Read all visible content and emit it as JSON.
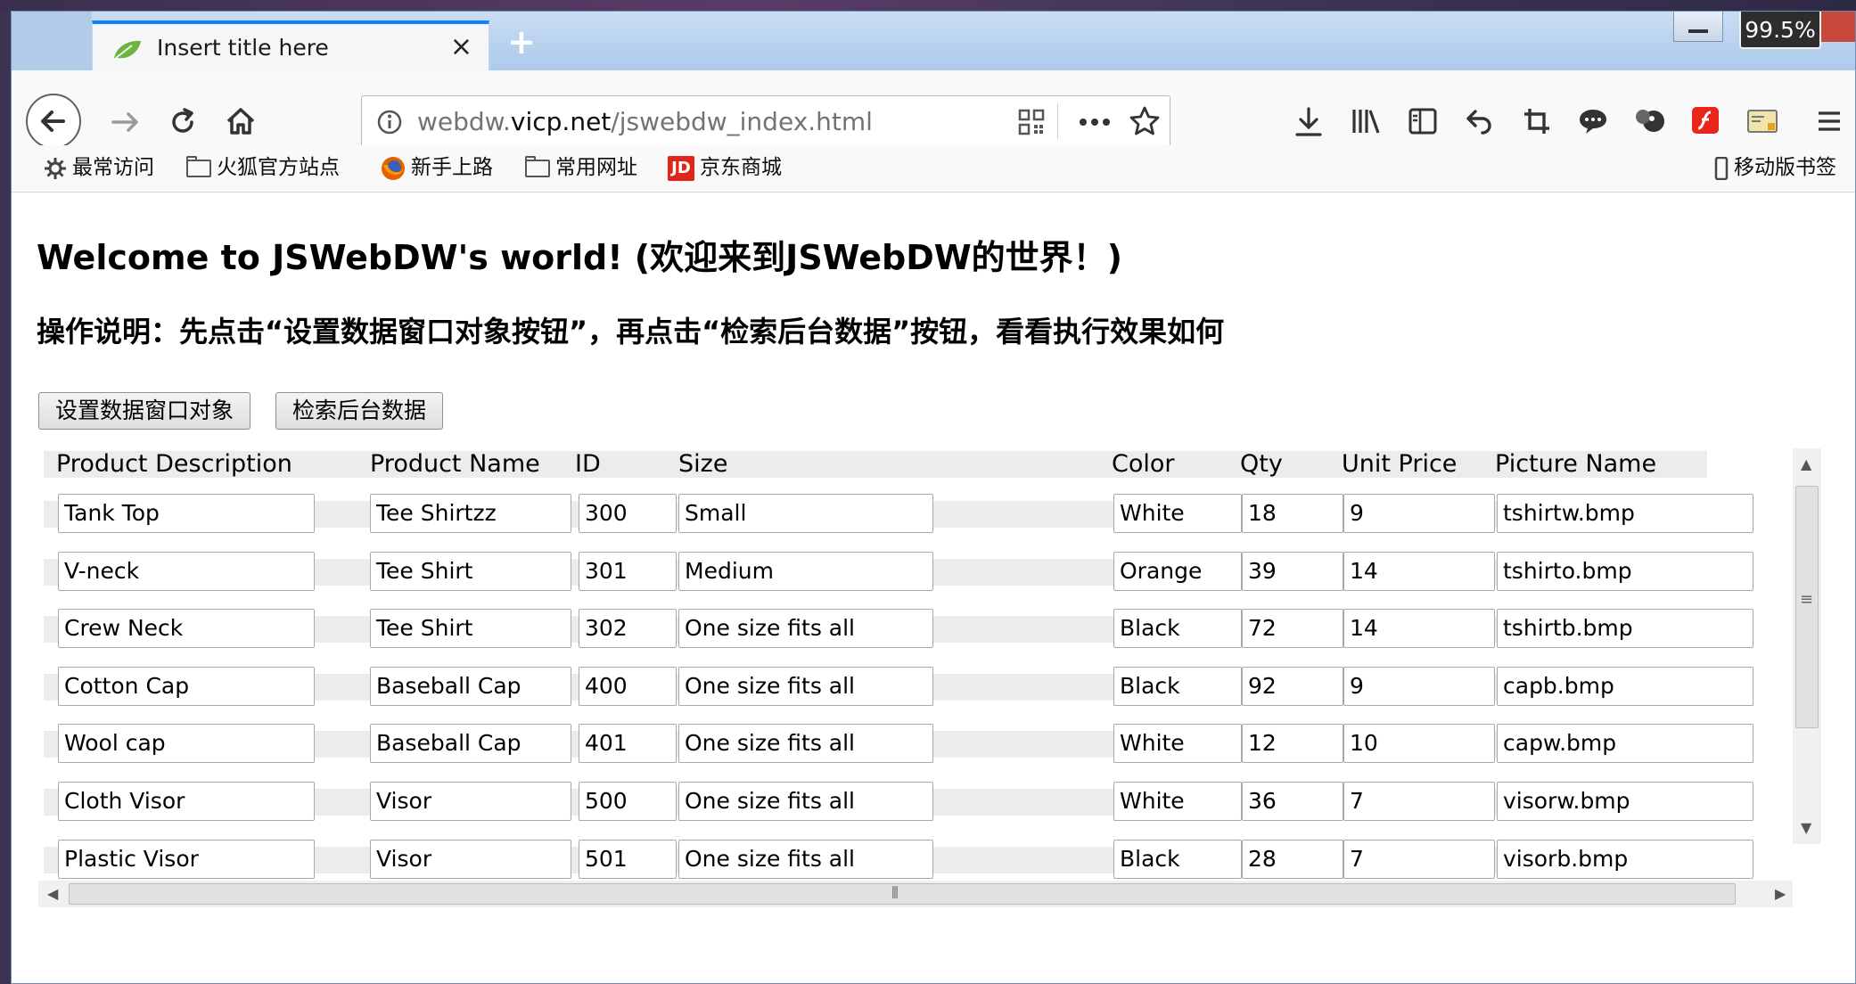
{
  "browser": {
    "tab_title": "Insert title here",
    "tab_close": "×",
    "new_tab": "+",
    "zoom": "99.5%",
    "url_prefix": "webdw.",
    "url_domain": "vicp.net",
    "url_path": "/jswebdw_index.html",
    "bookmarks": [
      "最常访问",
      "火狐官方站点",
      "新手上路",
      "常用网址",
      "京东商城"
    ],
    "bookmark_jd_logo": "JD",
    "mobile_bookmarks": "移动版书签",
    "accent_color": "#0a84ff"
  },
  "page": {
    "title": "Welcome to JSWebDW's world! (欢迎来到JSWebDW的世界！)",
    "instructions": "操作说明：先点击“设置数据窗口对象按钮”，再点击“检索后台数据”按钮，看看执行效果如何",
    "buttons": {
      "set_dw_object": "设置数据窗口对象",
      "retrieve_data": "检索后台数据"
    }
  },
  "grid": {
    "columns": [
      "Product Description",
      "Product Name",
      "ID",
      "Size",
      "Color",
      "Qty",
      "Unit Price",
      "Picture Name"
    ],
    "rows": [
      [
        "Tank Top",
        "Tee Shirtzz",
        "300",
        "Small",
        "White",
        "18",
        "9",
        "tshirtw.bmp"
      ],
      [
        "V-neck",
        "Tee Shirt",
        "301",
        "Medium",
        "Orange",
        "39",
        "14",
        "tshirto.bmp"
      ],
      [
        "Crew Neck",
        "Tee Shirt",
        "302",
        "One size fits all",
        "Black",
        "72",
        "14",
        "tshirtb.bmp"
      ],
      [
        "Cotton Cap",
        "Baseball Cap",
        "400",
        "One size fits all",
        "Black",
        "92",
        "9",
        "capb.bmp"
      ],
      [
        "Wool cap",
        "Baseball Cap",
        "401",
        "One size fits all",
        "White",
        "12",
        "10",
        "capw.bmp"
      ],
      [
        "Cloth Visor",
        "Visor",
        "500",
        "One size fits all",
        "White",
        "36",
        "7",
        "visorw.bmp"
      ],
      [
        "Plastic Visor",
        "Visor",
        "501",
        "One size fits all",
        "Black",
        "28",
        "7",
        "visorb.bmp"
      ]
    ]
  }
}
